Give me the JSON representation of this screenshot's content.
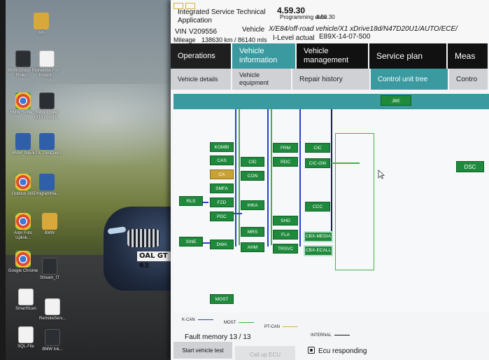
{
  "desktop": {
    "icons": [
      {
        "label": "ists",
        "glyph": "folder"
      },
      {
        "label": "BMW Group ISP Roller...",
        "glyph": "dark"
      },
      {
        "label": "Onetime For Instant...",
        "glyph": "doc"
      },
      {
        "label": "BMW ScWe...",
        "glyph": "chrome"
      },
      {
        "label": "BMW Group ISTA ProdD...",
        "glyph": "dark"
      },
      {
        "label": "BMW_Nav5",
        "glyph": "blue"
      },
      {
        "label": "ETK ThinClient",
        "glyph": "blue"
      },
      {
        "label": "Outlook 365",
        "glyph": "chrome"
      },
      {
        "label": "Programma...",
        "glyph": "blue"
      },
      {
        "label": "Anpr Foto Uplink...",
        "glyph": "chrome"
      },
      {
        "label": "BMW",
        "glyph": "folder"
      },
      {
        "label": "Google Chrome",
        "glyph": "chrome"
      },
      {
        "label": "Stream_IT",
        "glyph": "dark"
      },
      {
        "label": "SmartScan",
        "glyph": "doc"
      },
      {
        "label": "RemoteServ...",
        "glyph": "doc"
      },
      {
        "label": "SQL-File",
        "glyph": "doc"
      },
      {
        "label": "BMW Ink...",
        "glyph": "dark"
      }
    ],
    "wallpaper_plate": "OAL GT 63"
  },
  "app": {
    "window_title_line1": "Integrated Service Technical",
    "window_title_line2": "Application",
    "version": "4.59.30",
    "programming_data_label": "Programming data:",
    "programming_data_value": "4.59.30",
    "vin_label": "VIN",
    "vin_value": "V209556",
    "vehicle_label": "Vehicle",
    "vehicle_value": "X/E84/off-road vehicle/X1 xDrive18d/N47D20U1/AUTO/ECE/",
    "mileage_label": "Mileage",
    "mileage_value": "138630 km / 86140 mls",
    "ilevel_label": "I-Level actual",
    "ilevel_value": "E89X-14-07-500",
    "main_tabs": [
      "Operations",
      "Vehicle information",
      "Vehicle management",
      "Service plan",
      "Meas"
    ],
    "sub_tabs": [
      "Vehicle details",
      "Vehicle equipment",
      "Repair history",
      "Control unit tree",
      "Contro"
    ],
    "diagram": {
      "top_ecu": "JBE",
      "ecus": {
        "kombi": "KOMBI",
        "cas": "CAS",
        "ca": "CA",
        "smfa": "SMFA",
        "fzd": "FZD",
        "pdc": "PDC",
        "rls": "RLS",
        "sine": "SINE",
        "dwa": "DWA",
        "most": "MOST",
        "cid": "CID",
        "con": "CON",
        "ihka": "IHKA",
        "mrs": "MRS",
        "ahm": "AHM",
        "frm": "FRM",
        "rdc": "RDC",
        "shd": "SHD",
        "fla": "FLA",
        "trsvc": "TRSVC",
        "cic": "CIC",
        "cic_gw": "CIC-GW",
        "ccc": "CCC",
        "cbx_media": "CBX-MEDIA",
        "cbx_ecall": "CBX-ECALL",
        "dsc": "DSC"
      }
    },
    "legend": {
      "kcan": "K-CAN",
      "most": "MOST",
      "ptcan": "PT-CAN",
      "internal": "INTERNAL",
      "colors": {
        "kcan": "#2a3fd0",
        "most": "#45b04a",
        "ptcan": "#d9b24a",
        "internal": "#111111"
      }
    },
    "fault_memory_label": "Fault memory",
    "fault_memory_value": "13 / 13",
    "buttons": {
      "start_vehicle_test": "Start vehicle test",
      "call_up_ecu": "Call up ECU"
    },
    "ecu_responding": "Ecu responding"
  }
}
